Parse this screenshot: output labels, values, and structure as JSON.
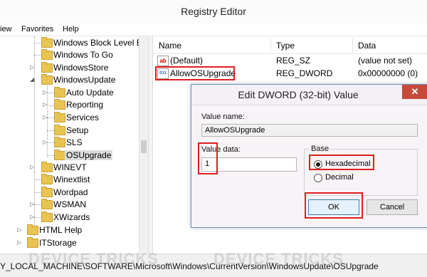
{
  "window": {
    "title": "Registry Editor"
  },
  "menu": {
    "view": "iew",
    "favorites": "Favorites",
    "help": "Help"
  },
  "tree": {
    "items": [
      {
        "label": "Windows Block Level B"
      },
      {
        "label": "Windows To Go"
      },
      {
        "label": "WindowsStore"
      },
      {
        "label": "WindowsUpdate"
      },
      {
        "label": "Auto Update"
      },
      {
        "label": "Reporting"
      },
      {
        "label": "Services"
      },
      {
        "label": "Setup"
      },
      {
        "label": "SLS"
      },
      {
        "label": "OSUpgrade"
      },
      {
        "label": "WINEVT"
      },
      {
        "label": "Winextlist"
      },
      {
        "label": "Wordpad"
      },
      {
        "label": "WSMAN"
      },
      {
        "label": "XWizards"
      },
      {
        "label": "HTML Help"
      },
      {
        "label": "ITStorage"
      }
    ]
  },
  "values_list": {
    "headers": {
      "name": "Name",
      "type": "Type",
      "data": "Data"
    },
    "rows": [
      {
        "name": "(Default)",
        "type": "REG_SZ",
        "data": "(value not set)",
        "icon": "ab"
      },
      {
        "name": "AllowOSUpgrade",
        "type": "REG_DWORD",
        "data": "0x00000000 (0)",
        "icon": "binary"
      }
    ]
  },
  "dialog": {
    "title": "Edit DWORD (32-bit) Value",
    "close": "✕",
    "value_name_label": "Value name:",
    "value_name": "AllowOSUpgrade",
    "value_data_label": "Value data:",
    "value_data": "1",
    "base_label": "Base",
    "hex_label": "Hexadecimal",
    "dec_label": "Decimal",
    "ok_label": "OK",
    "cancel_label": "Cancel"
  },
  "status": {
    "path": "Y_LOCAL_MACHINE\\SOFTWARE\\Microsoft\\Windows\\CurrentVersion\\WindowsUpdate\\OSUpgrade",
    "watermark": "DEVICE TRICKS"
  },
  "colors": {
    "highlight": "#e01e1e",
    "close": "#c7493a",
    "folder": "#e8c453"
  }
}
